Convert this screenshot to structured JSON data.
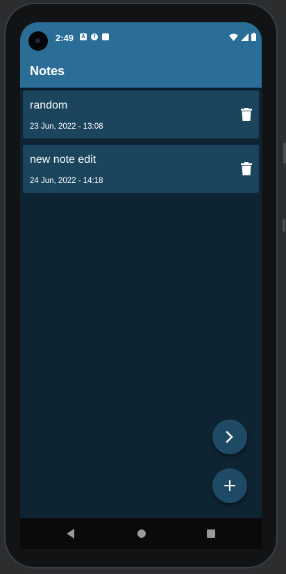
{
  "status_bar": {
    "time": "2:49",
    "left_icons": [
      "a-icon",
      "circle-f-icon",
      "sd-card-icon"
    ],
    "right_icons": [
      "wifi-icon",
      "signal-icon",
      "battery-icon"
    ]
  },
  "app_bar": {
    "title": "Notes"
  },
  "notes": [
    {
      "title": "random",
      "date": "23 Jun, 2022 - 13:08"
    },
    {
      "title": "new note edit",
      "date": "24 Jun, 2022 - 14:18"
    }
  ],
  "fabs": {
    "next_icon": "chevron-right-icon",
    "add_icon": "plus-icon"
  },
  "nav_bar": {
    "icons": [
      "back-triangle-icon",
      "home-circle-icon",
      "recents-square-icon"
    ]
  },
  "colors": {
    "app_bar": "#2a6e98",
    "background": "#0f2433",
    "card": "#1b445d",
    "fab": "#1f4a66"
  }
}
